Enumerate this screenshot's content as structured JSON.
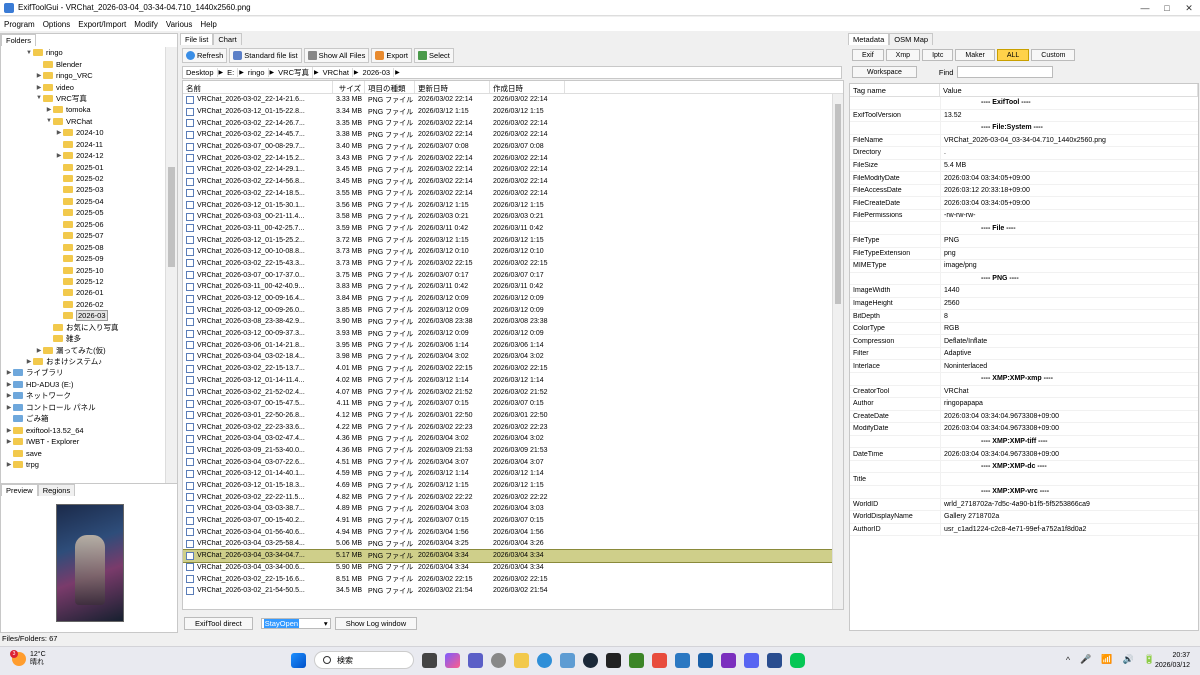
{
  "window": {
    "title": "ExifToolGui - VRChat_2026-03-04_03-34-04.710_1440x2560.png",
    "min": "—",
    "max": "□",
    "close": "✕"
  },
  "menu": [
    "Program",
    "Options",
    "Export/Import",
    "Modify",
    "Various",
    "Help"
  ],
  "folders": {
    "tab": "Folders",
    "tree": [
      {
        "label": "ringo",
        "indent": 2,
        "arrow": "v",
        "type": "folder"
      },
      {
        "label": "Blender",
        "indent": 3,
        "arrow": "",
        "type": "folder"
      },
      {
        "label": "ringo_VRC",
        "indent": 3,
        "arrow": ">",
        "type": "folder"
      },
      {
        "label": "video",
        "indent": 3,
        "arrow": ">",
        "type": "folder"
      },
      {
        "label": "VRC写真",
        "indent": 3,
        "arrow": "v",
        "type": "folder"
      },
      {
        "label": "tomoka",
        "indent": 4,
        "arrow": ">",
        "type": "folder"
      },
      {
        "label": "VRChat",
        "indent": 4,
        "arrow": "v",
        "type": "folder"
      },
      {
        "label": "2024-10",
        "indent": 5,
        "arrow": ">",
        "type": "folder"
      },
      {
        "label": "2024-11",
        "indent": 5,
        "arrow": "",
        "type": "folder"
      },
      {
        "label": "2024-12",
        "indent": 5,
        "arrow": ">",
        "type": "folder"
      },
      {
        "label": "2025-01",
        "indent": 5,
        "arrow": "",
        "type": "folder"
      },
      {
        "label": "2025-02",
        "indent": 5,
        "arrow": "",
        "type": "folder"
      },
      {
        "label": "2025-03",
        "indent": 5,
        "arrow": "",
        "type": "folder"
      },
      {
        "label": "2025-04",
        "indent": 5,
        "arrow": "",
        "type": "folder"
      },
      {
        "label": "2025-05",
        "indent": 5,
        "arrow": "",
        "type": "folder"
      },
      {
        "label": "2025-06",
        "indent": 5,
        "arrow": "",
        "type": "folder"
      },
      {
        "label": "2025-07",
        "indent": 5,
        "arrow": "",
        "type": "folder"
      },
      {
        "label": "2025-08",
        "indent": 5,
        "arrow": "",
        "type": "folder"
      },
      {
        "label": "2025-09",
        "indent": 5,
        "arrow": "",
        "type": "folder"
      },
      {
        "label": "2025-10",
        "indent": 5,
        "arrow": "",
        "type": "folder"
      },
      {
        "label": "2025-12",
        "indent": 5,
        "arrow": "",
        "type": "folder"
      },
      {
        "label": "2026-01",
        "indent": 5,
        "arrow": "",
        "type": "folder"
      },
      {
        "label": "2026-02",
        "indent": 5,
        "arrow": "",
        "type": "folder"
      },
      {
        "label": "2026-03",
        "indent": 5,
        "arrow": "",
        "type": "folder",
        "selected": true
      },
      {
        "label": "お気に入り写真",
        "indent": 4,
        "arrow": "",
        "type": "folder"
      },
      {
        "label": "雑多",
        "indent": 4,
        "arrow": "",
        "type": "folder"
      },
      {
        "label": "漏ってみた(仮)",
        "indent": 3,
        "arrow": ">",
        "type": "folder"
      },
      {
        "label": "おまけシステム♪",
        "indent": 2,
        "arrow": ">",
        "type": "folder"
      },
      {
        "label": "ライブラリ",
        "indent": 0,
        "arrow": ">",
        "type": "sys"
      },
      {
        "label": "HD-ADU3 (E:)",
        "indent": 0,
        "arrow": ">",
        "type": "sys"
      },
      {
        "label": "ネットワーク",
        "indent": 0,
        "arrow": ">",
        "type": "sys"
      },
      {
        "label": "コントロール パネル",
        "indent": 0,
        "arrow": ">",
        "type": "sys"
      },
      {
        "label": "ごみ箱",
        "indent": 0,
        "arrow": "",
        "type": "sys"
      },
      {
        "label": "exiftool-13.52_64",
        "indent": 0,
        "arrow": ">",
        "type": "folder"
      },
      {
        "label": "IWBT - Explorer",
        "indent": 0,
        "arrow": ">",
        "type": "folder"
      },
      {
        "label": "save",
        "indent": 0,
        "arrow": "",
        "type": "folder"
      },
      {
        "label": "trpg",
        "indent": 0,
        "arrow": ">",
        "type": "folder"
      }
    ]
  },
  "preview": {
    "tabs": [
      "Preview",
      "Regions"
    ]
  },
  "status": "Files/Folders: 67",
  "filepane": {
    "tabs": [
      "File list",
      "Chart"
    ],
    "toolbar": [
      "Refresh",
      "Standard file list",
      "Show All Files",
      "Export",
      "Select"
    ],
    "crumbs": [
      "Desktop",
      "E:",
      "ringo",
      "VRC写真",
      "VRChat",
      "2026-03"
    ],
    "columns": [
      "名前",
      "サイズ",
      "項目の種類",
      "更新日時",
      "作成日時"
    ],
    "rows": [
      [
        "VRChat_2026-03-02_22-14-21.6...",
        "3.33 MB",
        "PNG ファイル",
        "2026/03/02 22:14",
        "2026/03/02 22:14"
      ],
      [
        "VRChat_2026-03-12_01-15-22.8...",
        "3.34 MB",
        "PNG ファイル",
        "2026/03/12 1:15",
        "2026/03/12 1:15"
      ],
      [
        "VRChat_2026-03-02_22-14-26.7...",
        "3.35 MB",
        "PNG ファイル",
        "2026/03/02 22:14",
        "2026/03/02 22:14"
      ],
      [
        "VRChat_2026-03-02_22-14-45.7...",
        "3.38 MB",
        "PNG ファイル",
        "2026/03/02 22:14",
        "2026/03/02 22:14"
      ],
      [
        "VRChat_2026-03-07_00-08-29.7...",
        "3.40 MB",
        "PNG ファイル",
        "2026/03/07 0:08",
        "2026/03/07 0:08"
      ],
      [
        "VRChat_2026-03-02_22-14-15.2...",
        "3.43 MB",
        "PNG ファイル",
        "2026/03/02 22:14",
        "2026/03/02 22:14"
      ],
      [
        "VRChat_2026-03-02_22-14-29.1...",
        "3.45 MB",
        "PNG ファイル",
        "2026/03/02 22:14",
        "2026/03/02 22:14"
      ],
      [
        "VRChat_2026-03-02_22-14-56.8...",
        "3.45 MB",
        "PNG ファイル",
        "2026/03/02 22:14",
        "2026/03/02 22:14"
      ],
      [
        "VRChat_2026-03-02_22-14-18.5...",
        "3.55 MB",
        "PNG ファイル",
        "2026/03/02 22:14",
        "2026/03/02 22:14"
      ],
      [
        "VRChat_2026-03-12_01-15-30.1...",
        "3.56 MB",
        "PNG ファイル",
        "2026/03/12 1:15",
        "2026/03/12 1:15"
      ],
      [
        "VRChat_2026-03-03_00-21-11.4...",
        "3.58 MB",
        "PNG ファイル",
        "2026/03/03 0:21",
        "2026/03/03 0:21"
      ],
      [
        "VRChat_2026-03-11_00-42-25.7...",
        "3.59 MB",
        "PNG ファイル",
        "2026/03/11 0:42",
        "2026/03/11 0:42"
      ],
      [
        "VRChat_2026-03-12_01-15-25.2...",
        "3.72 MB",
        "PNG ファイル",
        "2026/03/12 1:15",
        "2026/03/12 1:15"
      ],
      [
        "VRChat_2026-03-12_00-10-08.8...",
        "3.73 MB",
        "PNG ファイル",
        "2026/03/12 0:10",
        "2026/03/12 0:10"
      ],
      [
        "VRChat_2026-03-02_22-15-43.3...",
        "3.73 MB",
        "PNG ファイル",
        "2026/03/02 22:15",
        "2026/03/02 22:15"
      ],
      [
        "VRChat_2026-03-07_00-17-37.0...",
        "3.75 MB",
        "PNG ファイル",
        "2026/03/07 0:17",
        "2026/03/07 0:17"
      ],
      [
        "VRChat_2026-03-11_00-42-40.9...",
        "3.83 MB",
        "PNG ファイル",
        "2026/03/11 0:42",
        "2026/03/11 0:42"
      ],
      [
        "VRChat_2026-03-12_00-09-16.4...",
        "3.84 MB",
        "PNG ファイル",
        "2026/03/12 0:09",
        "2026/03/12 0:09"
      ],
      [
        "VRChat_2026-03-12_00-09-26.0...",
        "3.85 MB",
        "PNG ファイル",
        "2026/03/12 0:09",
        "2026/03/12 0:09"
      ],
      [
        "VRChat_2026-03-08_23-38-42.9...",
        "3.90 MB",
        "PNG ファイル",
        "2026/03/08 23:38",
        "2026/03/08 23:38"
      ],
      [
        "VRChat_2026-03-12_00-09-37.3...",
        "3.93 MB",
        "PNG ファイル",
        "2026/03/12 0:09",
        "2026/03/12 0:09"
      ],
      [
        "VRChat_2026-03-06_01-14-21.8...",
        "3.95 MB",
        "PNG ファイル",
        "2026/03/06 1:14",
        "2026/03/06 1:14"
      ],
      [
        "VRChat_2026-03-04_03-02-18.4...",
        "3.98 MB",
        "PNG ファイル",
        "2026/03/04 3:02",
        "2026/03/04 3:02"
      ],
      [
        "VRChat_2026-03-02_22-15-13.7...",
        "4.01 MB",
        "PNG ファイル",
        "2026/03/02 22:15",
        "2026/03/02 22:15"
      ],
      [
        "VRChat_2026-03-12_01-14-11.4...",
        "4.02 MB",
        "PNG ファイル",
        "2026/03/12 1:14",
        "2026/03/12 1:14"
      ],
      [
        "VRChat_2026-03-02_21-52-02.4...",
        "4.07 MB",
        "PNG ファイル",
        "2026/03/02 21:52",
        "2026/03/02 21:52"
      ],
      [
        "VRChat_2026-03-07_00-15-47.5...",
        "4.11 MB",
        "PNG ファイル",
        "2026/03/07 0:15",
        "2026/03/07 0:15"
      ],
      [
        "VRChat_2026-03-01_22-50-26.8...",
        "4.12 MB",
        "PNG ファイル",
        "2026/03/01 22:50",
        "2026/03/01 22:50"
      ],
      [
        "VRChat_2026-03-02_22-23-33.6...",
        "4.22 MB",
        "PNG ファイル",
        "2026/03/02 22:23",
        "2026/03/02 22:23"
      ],
      [
        "VRChat_2026-03-04_03-02-47.4...",
        "4.36 MB",
        "PNG ファイル",
        "2026/03/04 3:02",
        "2026/03/04 3:02"
      ],
      [
        "VRChat_2026-03-09_21-53-40.0...",
        "4.36 MB",
        "PNG ファイル",
        "2026/03/09 21:53",
        "2026/03/09 21:53"
      ],
      [
        "VRChat_2026-03-04_03-07-22.6...",
        "4.51 MB",
        "PNG ファイル",
        "2026/03/04 3:07",
        "2026/03/04 3:07"
      ],
      [
        "VRChat_2026-03-12_01-14-40.1...",
        "4.59 MB",
        "PNG ファイル",
        "2026/03/12 1:14",
        "2026/03/12 1:14"
      ],
      [
        "VRChat_2026-03-12_01-15-18.3...",
        "4.69 MB",
        "PNG ファイル",
        "2026/03/12 1:15",
        "2026/03/12 1:15"
      ],
      [
        "VRChat_2026-03-02_22-22-11.5...",
        "4.82 MB",
        "PNG ファイル",
        "2026/03/02 22:22",
        "2026/03/02 22:22"
      ],
      [
        "VRChat_2026-03-04_03-03-38.7...",
        "4.89 MB",
        "PNG ファイル",
        "2026/03/04 3:03",
        "2026/03/04 3:03"
      ],
      [
        "VRChat_2026-03-07_00-15-40.2...",
        "4.91 MB",
        "PNG ファイル",
        "2026/03/07 0:15",
        "2026/03/07 0:15"
      ],
      [
        "VRChat_2026-03-04_01-56-40.6...",
        "4.94 MB",
        "PNG ファイル",
        "2026/03/04 1:56",
        "2026/03/04 1:56"
      ],
      [
        "VRChat_2026-03-04_03-25-58.4...",
        "5.06 MB",
        "PNG ファイル",
        "2026/03/04 3:25",
        "2026/03/04 3:26"
      ],
      [
        "VRChat_2026-03-04_03-34-04.7...",
        "5.17 MB",
        "PNG ファイル",
        "2026/03/04 3:34",
        "2026/03/04 3:34"
      ],
      [
        "VRChat_2026-03-04_03-34-00.6...",
        "5.90 MB",
        "PNG ファイル",
        "2026/03/04 3:34",
        "2026/03/04 3:34"
      ],
      [
        "VRChat_2026-03-02_22-15-16.6...",
        "8.51 MB",
        "PNG ファイル",
        "2026/03/02 22:15",
        "2026/03/02 22:15"
      ],
      [
        "VRChat_2026-03-02_21-54-50.5...",
        "34.5 MB",
        "PNG ファイル",
        "2026/03/02 21:54",
        "2026/03/02 21:54"
      ]
    ],
    "selected_row": 39,
    "bottom": {
      "exif_direct": "ExifTool direct",
      "stayopen": "StayOpen",
      "log": "Show Log window"
    }
  },
  "metapane": {
    "tabs": [
      "Metadata",
      "OSM Map"
    ],
    "groups": [
      "Exif",
      "Xmp",
      "Iptc",
      "Maker",
      "ALL",
      "Custom"
    ],
    "active_group": "ALL",
    "workspace": "Workspace",
    "find_label": "Find",
    "columns": [
      "Tag name",
      "Value"
    ],
    "rows": [
      {
        "h": "---- ExifTool ----"
      },
      {
        "k": "ExifToolVersion",
        "v": "13.52"
      },
      {
        "h": "---- File:System ----"
      },
      {
        "k": "FileName",
        "v": "VRChat_2026-03-04_03-34-04.710_1440x2560.png"
      },
      {
        "k": "Directory",
        "v": "."
      },
      {
        "k": "FileSize",
        "v": "5.4 MB"
      },
      {
        "k": "FileModifyDate",
        "v": "2026:03:04 03:34:05+09:00"
      },
      {
        "k": "FileAccessDate",
        "v": "2026:03:12 20:33:18+09:00"
      },
      {
        "k": "FileCreateDate",
        "v": "2026:03:04 03:34:05+09:00"
      },
      {
        "k": "FilePermissions",
        "v": "-rw-rw-rw-"
      },
      {
        "h": "---- File ----"
      },
      {
        "k": "FileType",
        "v": "PNG"
      },
      {
        "k": "FileTypeExtension",
        "v": "png"
      },
      {
        "k": "MIMEType",
        "v": "image/png"
      },
      {
        "h": "---- PNG ----"
      },
      {
        "k": "ImageWidth",
        "v": "1440"
      },
      {
        "k": "ImageHeight",
        "v": "2560"
      },
      {
        "k": "BitDepth",
        "v": "8"
      },
      {
        "k": "ColorType",
        "v": "RGB"
      },
      {
        "k": "Compression",
        "v": "Deflate/Inflate"
      },
      {
        "k": "Filter",
        "v": "Adaptive"
      },
      {
        "k": "Interlace",
        "v": "Noninterlaced"
      },
      {
        "h": "---- XMP:XMP-xmp ----"
      },
      {
        "k": "CreatorTool",
        "v": "VRChat"
      },
      {
        "k": "Author",
        "v": "ringopapapa"
      },
      {
        "k": "CreateDate",
        "v": "2026:03:04 03:34:04.9673308+09:00"
      },
      {
        "k": "ModifyDate",
        "v": "2026:03:04 03:34:04.9673308+09:00"
      },
      {
        "h": "---- XMP:XMP-tiff ----"
      },
      {
        "k": "DateTime",
        "v": "2026:03:04 03:34:04.9673308+09:00"
      },
      {
        "h": "---- XMP:XMP-dc ----"
      },
      {
        "k": "Title",
        "v": ""
      },
      {
        "h": "---- XMP:XMP-vrc ----"
      },
      {
        "k": "WorldID",
        "v": "wrld_2718702a-7d5c-4a90-b1f5-5f5253866ca9"
      },
      {
        "k": "WorldDisplayName",
        "v": "Gallery 2718702a"
      },
      {
        "k": "AuthorID",
        "v": "usr_c1ad1224-c2c8-4e71-99ef-a752a1f8d0a2"
      }
    ]
  },
  "taskbar": {
    "temp": "12°C",
    "weather": "晴れ",
    "weather_badge": "3",
    "search": "検索",
    "time": "20:37",
    "date": "2026/03/12",
    "tray": [
      "^",
      "🎤",
      "📶",
      "🔊",
      "🔋"
    ]
  }
}
